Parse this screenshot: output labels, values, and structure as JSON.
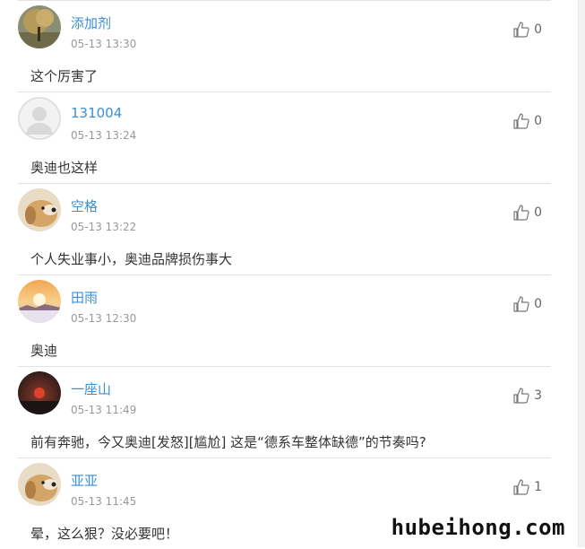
{
  "comments": [
    {
      "username": "添加剂",
      "timestamp": "05-13 13:30",
      "likes": "0",
      "text": "这个厉害了",
      "avatar": "tree-photo-avatar"
    },
    {
      "username": "131004",
      "timestamp": "05-13 13:24",
      "likes": "0",
      "text": "奥迪也这样",
      "avatar": "default-user-avatar"
    },
    {
      "username": "空格",
      "timestamp": "05-13 13:22",
      "likes": "0",
      "text": "个人失业事小，奥迪品牌损伤事大",
      "avatar": "dog-photo-avatar"
    },
    {
      "username": "田雨",
      "timestamp": "05-13 12:30",
      "likes": "0",
      "text": "奥迪",
      "avatar": "sunset-photo-avatar"
    },
    {
      "username": "一座山",
      "timestamp": "05-13 11:49",
      "likes": "3",
      "text": "前有奔驰，今又奥迪[发怒][尴尬] 这是“德系车整体缺德”的节奏吗?",
      "avatar": "red-sun-photo-avatar"
    },
    {
      "username": "亚亚",
      "timestamp": "05-13 11:45",
      "likes": "1",
      "text": "晕，这么狠？没必要吧！",
      "avatar": "dog-photo-avatar"
    }
  ],
  "watermark": "hubeihong.com",
  "colors": {
    "username": "#3b8fd3",
    "timestamp": "#999999",
    "divider": "#e2e2e2",
    "text": "#333333"
  }
}
